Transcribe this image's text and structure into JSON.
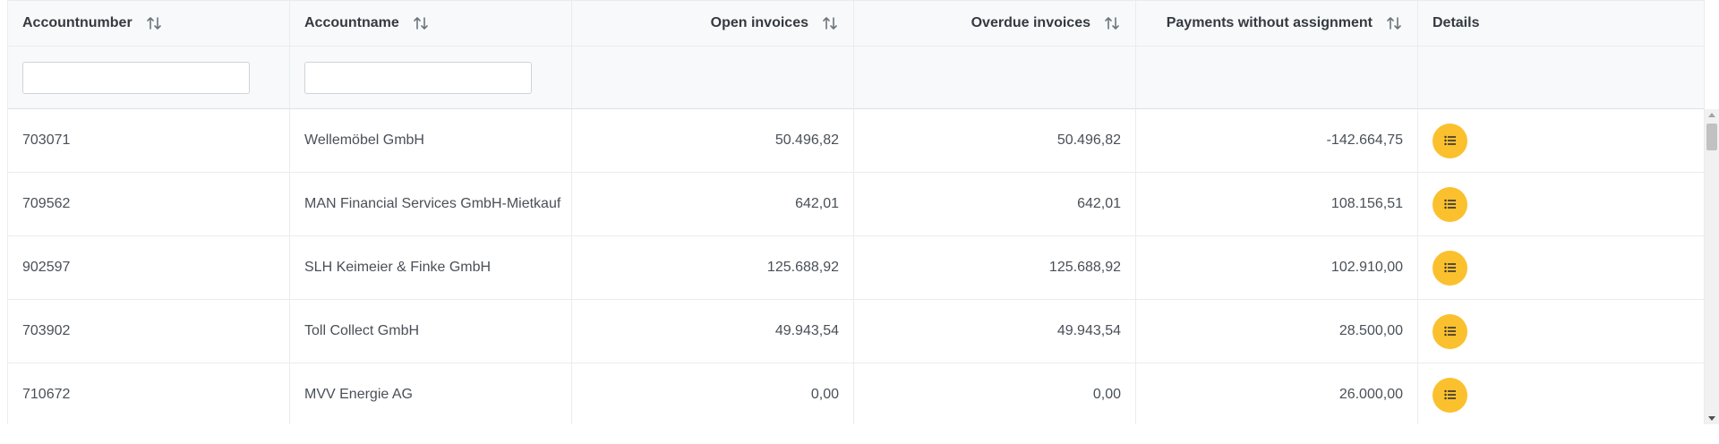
{
  "table": {
    "headers": {
      "account_number": "Accountnumber",
      "account_name": "Accountname",
      "open_invoices": "Open invoices",
      "overdue_invoices": "Overdue invoices",
      "payments_unassigned": "Payments without assignment",
      "details": "Details"
    },
    "filters": {
      "account_number": "",
      "account_name": ""
    },
    "rows": [
      {
        "account_number": "703071",
        "account_name": "Wellemöbel GmbH",
        "open_invoices": "50.496,82",
        "overdue_invoices": "50.496,82",
        "payments_unassigned": "-142.664,75"
      },
      {
        "account_number": "709562",
        "account_name": "MAN Financial Services GmbH-Mietkauf",
        "open_invoices": "642,01",
        "overdue_invoices": "642,01",
        "payments_unassigned": "108.156,51"
      },
      {
        "account_number": "902597",
        "account_name": "SLH Keimeier & Finke GmbH",
        "open_invoices": "125.688,92",
        "overdue_invoices": "125.688,92",
        "payments_unassigned": "102.910,00"
      },
      {
        "account_number": "703902",
        "account_name": "Toll Collect GmbH",
        "open_invoices": "49.943,54",
        "overdue_invoices": "49.943,54",
        "payments_unassigned": "28.500,00"
      },
      {
        "account_number": "710672",
        "account_name": "MVV Energie AG",
        "open_invoices": "0,00",
        "overdue_invoices": "0,00",
        "payments_unassigned": "26.000,00"
      }
    ]
  },
  "icons": {
    "sort": "sort-arrows-icon",
    "details": "list-icon"
  },
  "colors": {
    "details_button": "#fbc02d",
    "header_bg": "#f8f9fa"
  }
}
